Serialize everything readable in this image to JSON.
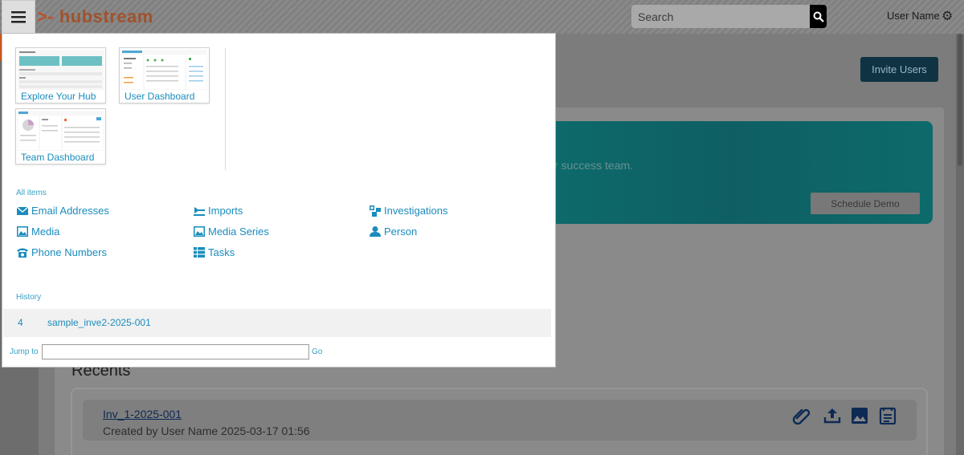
{
  "header": {
    "logo_text": "hubstream",
    "search_placeholder": "Search",
    "user_name": "User Name"
  },
  "background": {
    "invite_users_label": "Invite Users",
    "banner_text": "r success team.",
    "schedule_demo_label": "Schedule Demo",
    "recents_title": "Recents",
    "recent_item": {
      "link": "Inv_1-2025-001",
      "meta": "Created by User Name 2025-03-17 01:56"
    }
  },
  "menu": {
    "tiles": [
      {
        "label": "Explore Your Hub"
      },
      {
        "label": "User Dashboard"
      },
      {
        "label": "Team Dashboard"
      }
    ],
    "all_items_label": "All items",
    "items": [
      {
        "label": "Email Addresses",
        "icon": "envelope-icon"
      },
      {
        "label": "Imports",
        "icon": "import-icon"
      },
      {
        "label": "Investigations",
        "icon": "investigation-icon"
      },
      {
        "label": "Media",
        "icon": "image-icon"
      },
      {
        "label": "Media Series",
        "icon": "images-icon"
      },
      {
        "label": "Person",
        "icon": "person-icon"
      },
      {
        "label": "Phone Numbers",
        "icon": "phone-icon"
      },
      {
        "label": "Tasks",
        "icon": "tasks-icon"
      }
    ],
    "history_label": "History",
    "history": [
      {
        "num": "4",
        "name": "sample_inve2-2025-001"
      }
    ],
    "jump_to_label": "Jump to",
    "go_label": "Go"
  },
  "colors": {
    "link": "#1a8cbd",
    "brand_orange": "#c8561c",
    "navy_button": "#0f3342",
    "teal_banner": "#0d6b6b"
  }
}
